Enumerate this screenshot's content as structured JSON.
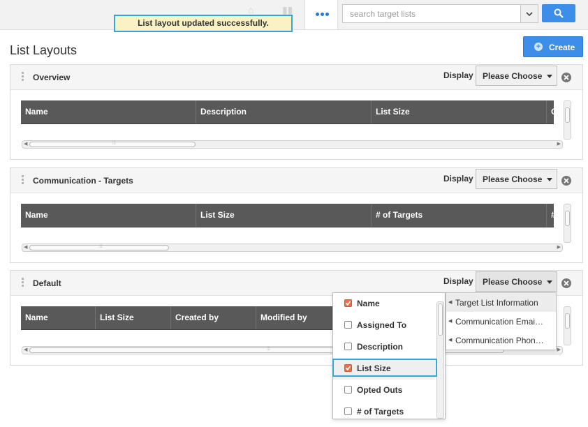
{
  "search": {
    "placeholder": "search target lists"
  },
  "notification": {
    "message": "List layout updated successfully."
  },
  "page": {
    "title": "List Layouts",
    "create_label": "Create"
  },
  "panels": [
    {
      "title": "Overview",
      "display_label": "Display",
      "select_value": "Please Choose",
      "columns": [
        "Name",
        "Description",
        "List Size",
        "Op"
      ]
    },
    {
      "title": "Communication - Targets",
      "display_label": "Display",
      "select_value": "Please Choose",
      "columns": [
        "Name",
        "List Size",
        "# of Targets",
        "# o"
      ]
    },
    {
      "title": "Default",
      "display_label": "Display",
      "select_value": "Please Choose",
      "columns": [
        "Name",
        "List Size",
        "Created by",
        "Modified by"
      ]
    }
  ],
  "checklist": {
    "items": [
      {
        "label": "Name",
        "checked": true
      },
      {
        "label": "Assigned To",
        "checked": false
      },
      {
        "label": "Description",
        "checked": false
      },
      {
        "label": "List Size",
        "checked": true
      },
      {
        "label": "Opted Outs",
        "checked": false
      },
      {
        "label": "# of Targets",
        "checked": false
      }
    ],
    "highlighted": "List Size"
  },
  "submenu": {
    "items": [
      "Target List Information",
      "Communication Emai…",
      "Communication Phon…"
    ],
    "active": "Target List Information"
  },
  "colors": {
    "accent": "#3d8ee8",
    "highlight_border": "#34a6d8",
    "toast_bg": "#fbf2c4",
    "header_bg": "#595959",
    "checkbox_on": "#e9734b"
  }
}
